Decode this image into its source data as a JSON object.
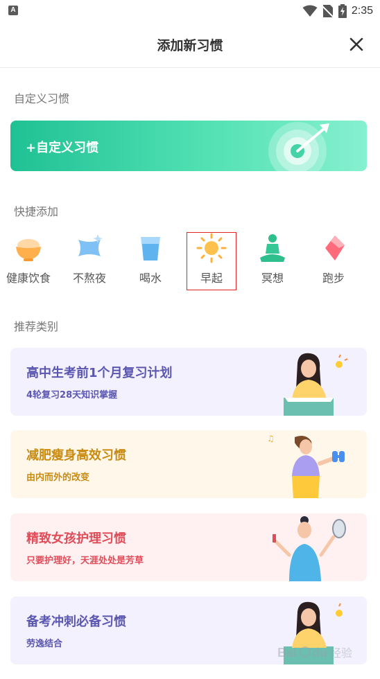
{
  "status_bar": {
    "time": "2:35",
    "app_indicator": "A"
  },
  "header": {
    "title": "添加新习惯"
  },
  "custom_section": {
    "label": "自定义习惯",
    "button_label": "+自定义习惯"
  },
  "quick_section": {
    "label": "快捷添加",
    "items": [
      {
        "label": "健康饮食",
        "icon": "bowl-icon"
      },
      {
        "label": "不熬夜",
        "icon": "pillow-icon"
      },
      {
        "label": "喝水",
        "icon": "cup-icon"
      },
      {
        "label": "早起",
        "icon": "sun-icon"
      },
      {
        "label": "冥想",
        "icon": "meditation-icon"
      },
      {
        "label": "跑步",
        "icon": "shoe-icon"
      }
    ]
  },
  "recommend_section": {
    "label": "推荐类别",
    "cards": [
      {
        "title": "高中生考前1个月复习计划",
        "subtitle": "4轮复习28天知识掌握",
        "bg": "#f2f1fd",
        "color": "#5b56b0"
      },
      {
        "title": "减肥瘦身高效习惯",
        "subtitle": "由内而外的改变",
        "bg": "#fff7ea",
        "color": "#c98a10"
      },
      {
        "title": "精致女孩护理习惯",
        "subtitle": "只要护理好，天涯处处是芳草",
        "bg": "#fff1f2",
        "color": "#e04c58"
      },
      {
        "title": "备考冲刺必备习惯",
        "subtitle": "劳逸结合",
        "bg": "#f2f1fd",
        "color": "#5b56b0"
      }
    ]
  },
  "colors": {
    "accent_green": "#1fc194",
    "selection_outline": "#e02424"
  },
  "watermark": {
    "text": "经验",
    "brand": "Bai du"
  }
}
